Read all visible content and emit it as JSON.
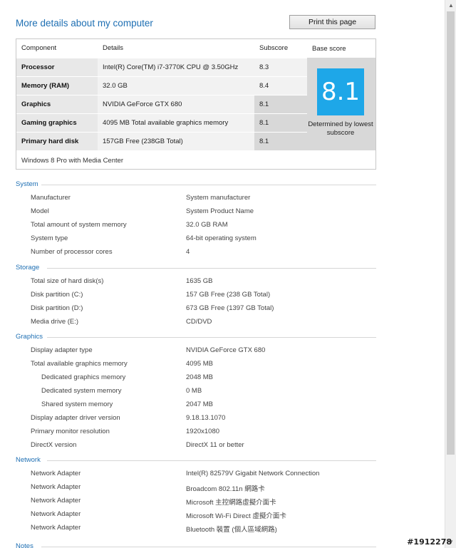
{
  "header": {
    "title": "More details about my computer",
    "print_label": "Print this page"
  },
  "score_table": {
    "columns": [
      "Component",
      "Details",
      "Subscore",
      "Base score"
    ],
    "rows": [
      {
        "component": "Processor",
        "details": "Intel(R) Core(TM) i7-3770K CPU @ 3.50GHz",
        "subscore": "8.3"
      },
      {
        "component": "Memory (RAM)",
        "details": "32.0 GB",
        "subscore": "8.4"
      },
      {
        "component": "Graphics",
        "details": "NVIDIA GeForce GTX 680",
        "subscore": "8.1"
      },
      {
        "component": "Gaming graphics",
        "details": "4095 MB Total available graphics memory",
        "subscore": "8.1"
      },
      {
        "component": "Primary hard disk",
        "details": "157GB Free (238GB Total)",
        "subscore": "8.1"
      }
    ],
    "base_score": "8.1",
    "base_note": "Determined by lowest subscore",
    "os": "Windows 8 Pro with Media Center"
  },
  "sections": {
    "system": {
      "title": "System",
      "rows": [
        {
          "k": "Manufacturer",
          "v": "System manufacturer"
        },
        {
          "k": "Model",
          "v": "System Product Name"
        },
        {
          "k": "Total amount of system memory",
          "v": "32.0 GB RAM"
        },
        {
          "k": "System type",
          "v": "64-bit operating system"
        },
        {
          "k": "Number of processor cores",
          "v": "4"
        }
      ]
    },
    "storage": {
      "title": "Storage",
      "rows": [
        {
          "k": "Total size of hard disk(s)",
          "v": "1635 GB"
        },
        {
          "k": "Disk partition (C:)",
          "v": "157 GB Free (238 GB Total)"
        },
        {
          "k": "Disk partition (D:)",
          "v": "673 GB Free (1397 GB Total)"
        },
        {
          "k": "Media drive (E:)",
          "v": "CD/DVD"
        }
      ]
    },
    "graphics": {
      "title": "Graphics",
      "rows": [
        {
          "k": "Display adapter type",
          "v": "NVIDIA GeForce GTX 680"
        },
        {
          "k": "Total available graphics memory",
          "v": "4095 MB"
        },
        {
          "k": "Dedicated graphics memory",
          "v": "2048 MB"
        },
        {
          "k": "Dedicated system memory",
          "v": "0 MB"
        },
        {
          "k": "Shared system memory",
          "v": "2047 MB"
        },
        {
          "k": "Display adapter driver version",
          "v": "9.18.13.1070"
        },
        {
          "k": "Primary monitor resolution",
          "v": "1920x1080"
        },
        {
          "k": "DirectX version",
          "v": "DirectX 11 or better"
        }
      ]
    },
    "network": {
      "title": "Network",
      "rows": [
        {
          "k": "Network Adapter",
          "v": "Intel(R) 82579V Gigabit Network Connection"
        },
        {
          "k": "Network Adapter",
          "v": "Broadcom 802.11n 網路卡"
        },
        {
          "k": "Network Adapter",
          "v": "Microsoft 主控網路虛擬介面卡"
        },
        {
          "k": "Network Adapter",
          "v": "Microsoft Wi-Fi Direct 虛擬介面卡"
        },
        {
          "k": "Network Adapter",
          "v": "Bluetooth 裝置 (個人區域網路)"
        }
      ]
    },
    "notes": {
      "title": "Notes"
    }
  },
  "watermark": "#1912278",
  "colors": {
    "accent": "#1e6fb3",
    "score_tile": "#1ea7e8"
  }
}
